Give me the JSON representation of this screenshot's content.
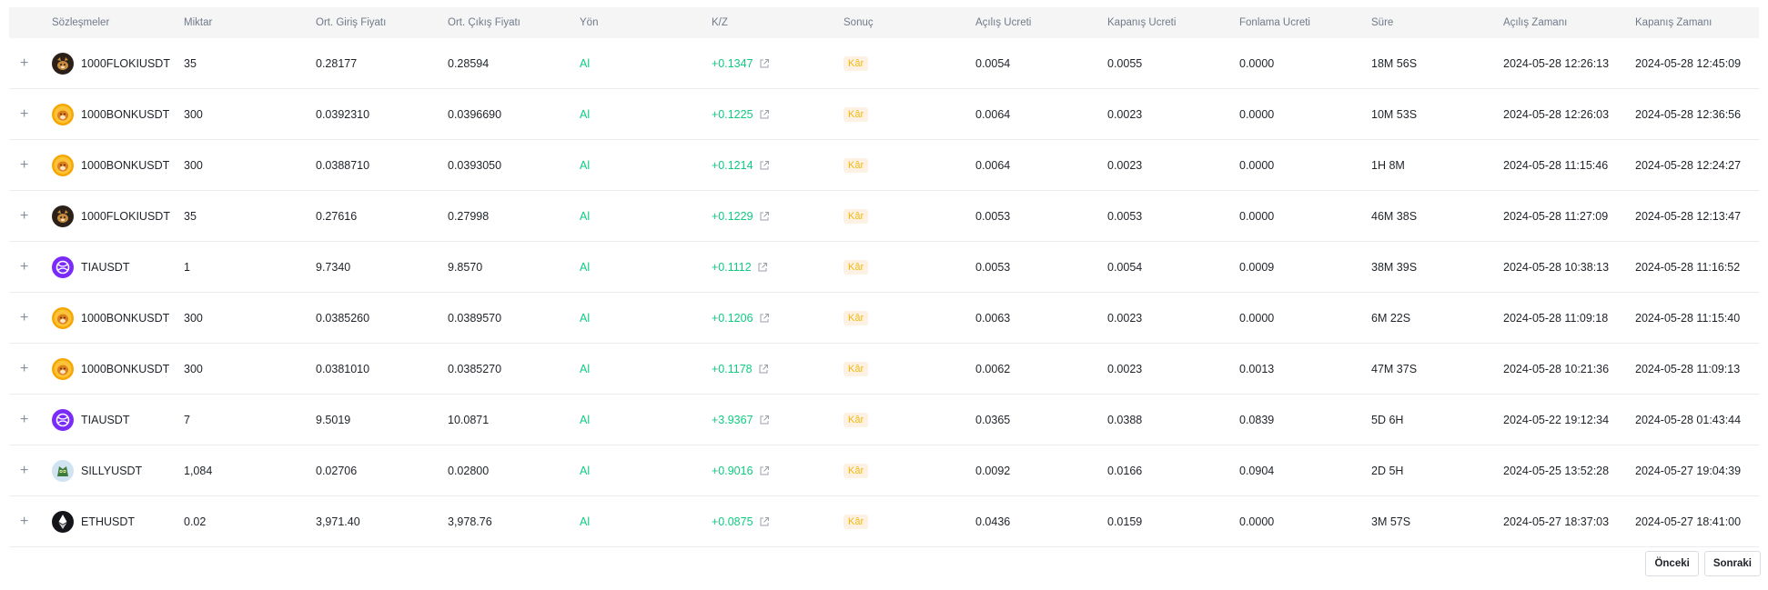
{
  "headers": [
    "",
    "Sözleşmeler",
    "Miktar",
    "Ort. Giriş Fiyatı",
    "Ort. Çıkış Fiyatı",
    "Yön",
    "K/Z",
    "Sonuç",
    "Açılış Ücreti",
    "Kapanış Ücreti",
    "Fonlama Ücreti",
    "Süre",
    "Açılış Zamanı",
    "Kapanış Zamanı"
  ],
  "colors": {
    "positive": "#0ecb81",
    "badge_text": "#f0b90b",
    "badge_bg": "#fdf1e4"
  },
  "rows": [
    {
      "expand": "+",
      "icon": "floki-coin-icon",
      "contract": "1000FLOKIUSDT",
      "qty": "35",
      "entry": "0.28177",
      "exit": "0.28594",
      "side": "Al",
      "pnl": "+0.1347",
      "result": "Kâr",
      "open_fee": "0.0054",
      "close_fee": "0.0055",
      "funding_fee": "0.0000",
      "duration": "18M 56S",
      "open_time": "2024-05-28 12:26:13",
      "close_time": "2024-05-28 12:45:09"
    },
    {
      "expand": "+",
      "icon": "bonk-coin-icon",
      "contract": "1000BONKUSDT",
      "qty": "300",
      "entry": "0.0392310",
      "exit": "0.0396690",
      "side": "Al",
      "pnl": "+0.1225",
      "result": "Kâr",
      "open_fee": "0.0064",
      "close_fee": "0.0023",
      "funding_fee": "0.0000",
      "duration": "10M 53S",
      "open_time": "2024-05-28 12:26:03",
      "close_time": "2024-05-28 12:36:56"
    },
    {
      "expand": "+",
      "icon": "bonk-coin-icon",
      "contract": "1000BONKUSDT",
      "qty": "300",
      "entry": "0.0388710",
      "exit": "0.0393050",
      "side": "Al",
      "pnl": "+0.1214",
      "result": "Kâr",
      "open_fee": "0.0064",
      "close_fee": "0.0023",
      "funding_fee": "0.0000",
      "duration": "1H 8M",
      "open_time": "2024-05-28 11:15:46",
      "close_time": "2024-05-28 12:24:27"
    },
    {
      "expand": "+",
      "icon": "floki-coin-icon",
      "contract": "1000FLOKIUSDT",
      "qty": "35",
      "entry": "0.27616",
      "exit": "0.27998",
      "side": "Al",
      "pnl": "+0.1229",
      "result": "Kâr",
      "open_fee": "0.0053",
      "close_fee": "0.0053",
      "funding_fee": "0.0000",
      "duration": "46M 38S",
      "open_time": "2024-05-28 11:27:09",
      "close_time": "2024-05-28 12:13:47"
    },
    {
      "expand": "+",
      "icon": "tia-coin-icon",
      "contract": "TIAUSDT",
      "qty": "1",
      "entry": "9.7340",
      "exit": "9.8570",
      "side": "Al",
      "pnl": "+0.1112",
      "result": "Kâr",
      "open_fee": "0.0053",
      "close_fee": "0.0054",
      "funding_fee": "0.0009",
      "duration": "38M 39S",
      "open_time": "2024-05-28 10:38:13",
      "close_time": "2024-05-28 11:16:52"
    },
    {
      "expand": "+",
      "icon": "bonk-coin-icon",
      "contract": "1000BONKUSDT",
      "qty": "300",
      "entry": "0.0385260",
      "exit": "0.0389570",
      "side": "Al",
      "pnl": "+0.1206",
      "result": "Kâr",
      "open_fee": "0.0063",
      "close_fee": "0.0023",
      "funding_fee": "0.0000",
      "duration": "6M 22S",
      "open_time": "2024-05-28 11:09:18",
      "close_time": "2024-05-28 11:15:40"
    },
    {
      "expand": "+",
      "icon": "bonk-coin-icon",
      "contract": "1000BONKUSDT",
      "qty": "300",
      "entry": "0.0381010",
      "exit": "0.0385270",
      "side": "Al",
      "pnl": "+0.1178",
      "result": "Kâr",
      "open_fee": "0.0062",
      "close_fee": "0.0023",
      "funding_fee": "0.0013",
      "duration": "47M 37S",
      "open_time": "2024-05-28 10:21:36",
      "close_time": "2024-05-28 11:09:13"
    },
    {
      "expand": "+",
      "icon": "tia-coin-icon",
      "contract": "TIAUSDT",
      "qty": "7",
      "entry": "9.5019",
      "exit": "10.0871",
      "side": "Al",
      "pnl": "+3.9367",
      "result": "Kâr",
      "open_fee": "0.0365",
      "close_fee": "0.0388",
      "funding_fee": "0.0839",
      "duration": "5D 6H",
      "open_time": "2024-05-22 19:12:34",
      "close_time": "2024-05-28 01:43:44"
    },
    {
      "expand": "+",
      "icon": "silly-coin-icon",
      "contract": "SILLYUSDT",
      "qty": "1,084",
      "entry": "0.02706",
      "exit": "0.02800",
      "side": "Al",
      "pnl": "+0.9016",
      "result": "Kâr",
      "open_fee": "0.0092",
      "close_fee": "0.0166",
      "funding_fee": "0.0904",
      "duration": "2D 5H",
      "open_time": "2024-05-25 13:52:28",
      "close_time": "2024-05-27 19:04:39"
    },
    {
      "expand": "+",
      "icon": "eth-coin-icon",
      "contract": "ETHUSDT",
      "qty": "0.02",
      "entry": "3,971.40",
      "exit": "3,978.76",
      "side": "Al",
      "pnl": "+0.0875",
      "result": "Kâr",
      "open_fee": "0.0436",
      "close_fee": "0.0159",
      "funding_fee": "0.0000",
      "duration": "3M 57S",
      "open_time": "2024-05-27 18:37:03",
      "close_time": "2024-05-27 18:41:00"
    }
  ],
  "pagination": {
    "prev_label": "Önceki",
    "next_label": "Sonraki"
  }
}
